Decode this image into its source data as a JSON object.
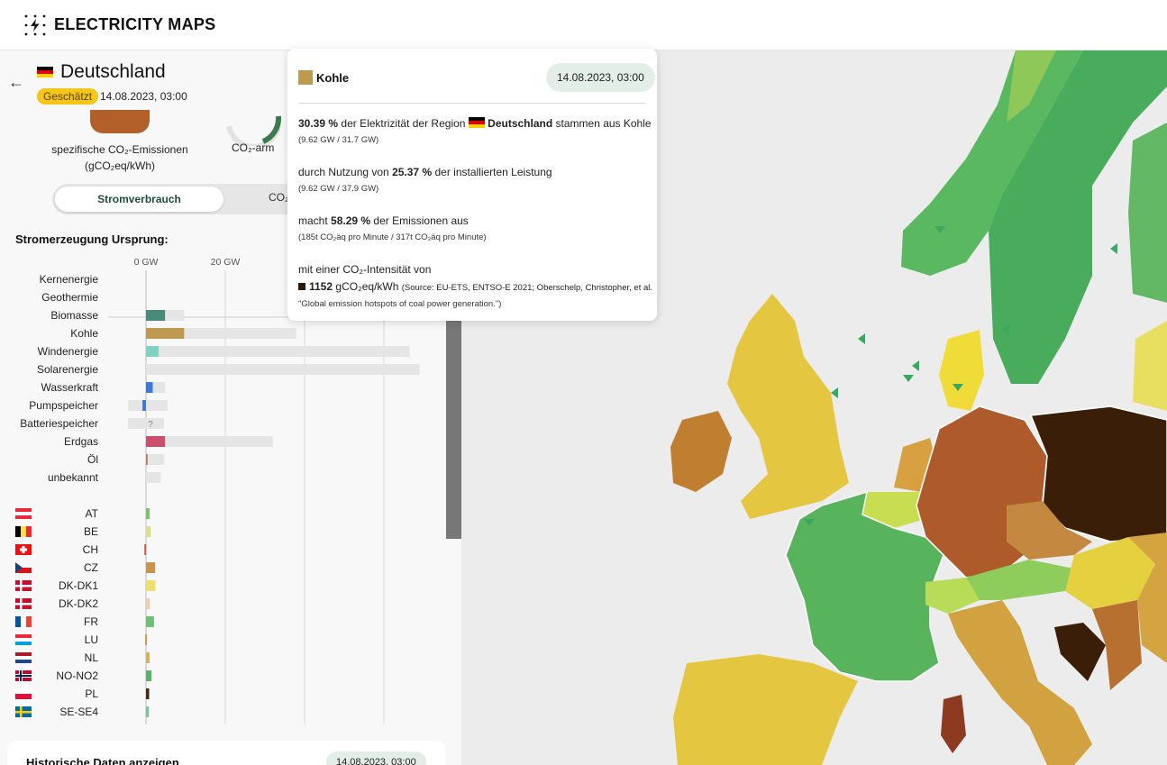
{
  "app": {
    "logo_text": "ELECTRICITY MAPS"
  },
  "zone": {
    "name": "Deutschland",
    "badge": "Geschätzt",
    "datetime": "14.08.2023, 03:00",
    "co2_label_1": "spezifische CO₂-Emissionen",
    "co2_label_2": "(gCO₂eq/kWh)",
    "lowcarbon_label": "CO₂-arm"
  },
  "toggle": {
    "active": "Stromverbrauch",
    "inactive": "CO₂"
  },
  "production": {
    "title": "Stromerzeugung Ursprung:",
    "axis_ticks": [
      "0 GW",
      "20 GW"
    ],
    "sources": [
      {
        "label": "Kernenergie",
        "value_gw": 0,
        "capacity_gw": 0,
        "color": "#8fa8a0"
      },
      {
        "label": "Geothermie",
        "value_gw": 0,
        "capacity_gw": 0,
        "color": "#8fa8a0"
      },
      {
        "label": "Biomasse",
        "value_gw": 4.8,
        "capacity_gw": 9.6,
        "color": "#4a8a78"
      },
      {
        "label": "Kohle",
        "value_gw": 9.62,
        "capacity_gw": 37.9,
        "color": "#bd9a50"
      },
      {
        "label": "Windenergie",
        "value_gw": 3.2,
        "capacity_gw": 66.5,
        "color": "#7fd3c0"
      },
      {
        "label": "Solarenergie",
        "value_gw": 0,
        "capacity_gw": 69.0,
        "color": "#f5c518"
      },
      {
        "label": "Wasserkraft",
        "value_gw": 1.7,
        "capacity_gw": 4.8,
        "color": "#3d7ad6"
      },
      {
        "label": "Pumpspeicher",
        "value_gw": -0.9,
        "capacity_gw": 9.9,
        "color": "#3d7ad6"
      },
      {
        "label": "Batteriespeicher",
        "value_gw": 0,
        "capacity_gw": 4.6,
        "color": "#aaaaaa",
        "unknown_mark": "?"
      },
      {
        "label": "Erdgas",
        "value_gw": 4.8,
        "capacity_gw": 32.0,
        "color": "#c94f6d"
      },
      {
        "label": "Öl",
        "value_gw": 0.4,
        "capacity_gw": 4.6,
        "color": "#b5785a"
      },
      {
        "label": "unbekannt",
        "value_gw": 0,
        "capacity_gw": 3.7,
        "color": "#aaaaaa"
      }
    ],
    "exchanges": [
      {
        "code": "AT",
        "value_gw": 0.9,
        "color": "#7cc26a",
        "flag": "at"
      },
      {
        "code": "BE",
        "value_gw": 1.2,
        "color": "#d8e08a",
        "flag": "be"
      },
      {
        "code": "CH",
        "value_gw": -0.4,
        "color": "#c25a4a",
        "flag": "ch"
      },
      {
        "code": "CZ",
        "value_gw": 2.3,
        "color": "#c9954a",
        "flag": "cz"
      },
      {
        "code": "DK-DK1",
        "value_gw": 2.4,
        "color": "#ece070",
        "flag": "dk"
      },
      {
        "code": "DK-DK2",
        "value_gw": 1.0,
        "color": "#e8d0b0",
        "flag": "dk"
      },
      {
        "code": "FR",
        "value_gw": 2.0,
        "color": "#6cc074",
        "flag": "fr"
      },
      {
        "code": "LU",
        "value_gw": -0.2,
        "color": "#c9954a",
        "flag": "lu"
      },
      {
        "code": "NL",
        "value_gw": 0.9,
        "color": "#d4b060",
        "flag": "nl"
      },
      {
        "code": "NO-NO2",
        "value_gw": 1.4,
        "color": "#5cb06a",
        "flag": "no"
      },
      {
        "code": "PL",
        "value_gw": 0.8,
        "color": "#4a2a14",
        "flag": "pl"
      },
      {
        "code": "SE-SE4",
        "value_gw": 0.7,
        "color": "#6cc8a0",
        "flag": "se"
      }
    ]
  },
  "history": {
    "title": "Historische Daten anzeigen",
    "datetime": "14.08.2023, 03:00"
  },
  "tooltip": {
    "source": "Kohle",
    "datetime": "14.08.2023, 03:00",
    "p1_pct": "30.39 %",
    "p1_text": "der Elektrizität der Region",
    "p1_zone": "Deutschland",
    "p1_tail": "stammen aus Kohle",
    "p1_sub": "(9.62 GW / 31.7 GW)",
    "p2_text": "durch Nutzung von",
    "p2_pct": "25.37 %",
    "p2_tail": "der installierten Leistung",
    "p2_sub": "(9.62 GW / 37.9 GW)",
    "p3_text": "macht",
    "p3_pct": "58.29 %",
    "p3_tail": "der Emissionen aus",
    "p3_sub": "(185t CO₂äq pro Minute / 317t CO₂äq pro Minute)",
    "p4_text": "mit einer CO₂-Intensität von",
    "p4_value": "1152",
    "p4_unit": "gCO₂eq/kWh",
    "p4_source": "(Source: EU-ETS, ENTSO-E 2021; Oberschelp, Christopher, et al.",
    "p4_source_2": "\"Global emission hotspots of coal power generation.\")"
  },
  "colors": {
    "accent": "#1e4e3c",
    "badge": "#f5c518",
    "coal": "#bd9a50"
  }
}
